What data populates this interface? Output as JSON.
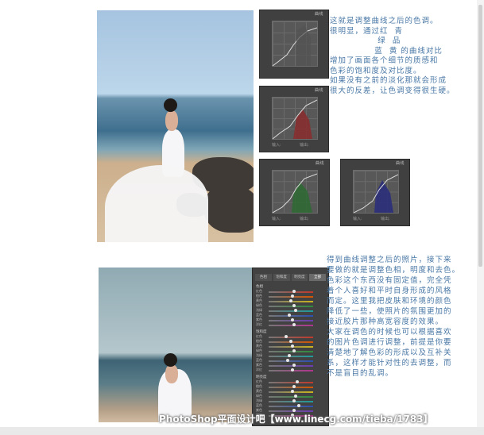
{
  "curve_panels": [
    {
      "title": "曲线",
      "footer_left": "",
      "footer_right": "",
      "curve_color": "#d8d8d8",
      "fill": "#4e4e4e"
    },
    {
      "title": "曲线",
      "footer_left": "输入:",
      "footer_right": "输出:",
      "curve_color": "#dcdcdc",
      "fill": "#8a2b2b"
    },
    {
      "title": "曲线",
      "footer_left": "输入:",
      "footer_right": "输出:",
      "curve_color": "#dcdcdc",
      "fill": "#2e6a33"
    },
    {
      "title": "曲线",
      "footer_left": "输入:",
      "footer_right": "输出:",
      "curve_color": "#dcdcdc",
      "fill": "#2b2f7a"
    }
  ],
  "note_top": "这就是调整曲线之后的色调。\n很明显，通过红  青\n               绿  品\n              蓝  黄 的曲线对比\n增加了画面各个细节的质感和\n色彩的饱和度及对比度。\n如果没有之前的淡化那就会形成\n很大的反差，让色调变得很生硬。",
  "note_bottom": "得到曲线调整之后的照片，接下来\n要做的就是调整色相，明度和去色。\n色彩这个东西没有固定值，完全凭\n着个人喜好和平时自身形成的风格\n而定。这里我把皮肤和环境的颜色\n降低了一些，使照片的氛围更加的\n接近胶片那种高宽容度的效果。\n大家在调色的时候也可以根据喜欢\n的图片色调进行调整，前提是你要\n清楚地了解色彩的形成以及互补关\n系，这样才能针对性的去调整，而\n不是盲目的乱调。",
  "hsl": {
    "tabs": [
      "色相",
      "饱和度",
      "明亮度",
      "全部"
    ],
    "sections": [
      "色相",
      "饱和度",
      "明亮度"
    ],
    "rows": [
      "红色",
      "橙色",
      "黄色",
      "绿色",
      "浅绿",
      "蓝色",
      "紫色",
      "洋红"
    ],
    "tracks_hue": [
      "#c0392b",
      "#d35400",
      "#c9b21d",
      "#2e8b3c",
      "#1f9a99",
      "#2c4fb0",
      "#6a3bb0",
      "#b0358e"
    ]
  },
  "watermark": "PhotoShop平面设计吧【www.linecg.com/tieba/1783】"
}
